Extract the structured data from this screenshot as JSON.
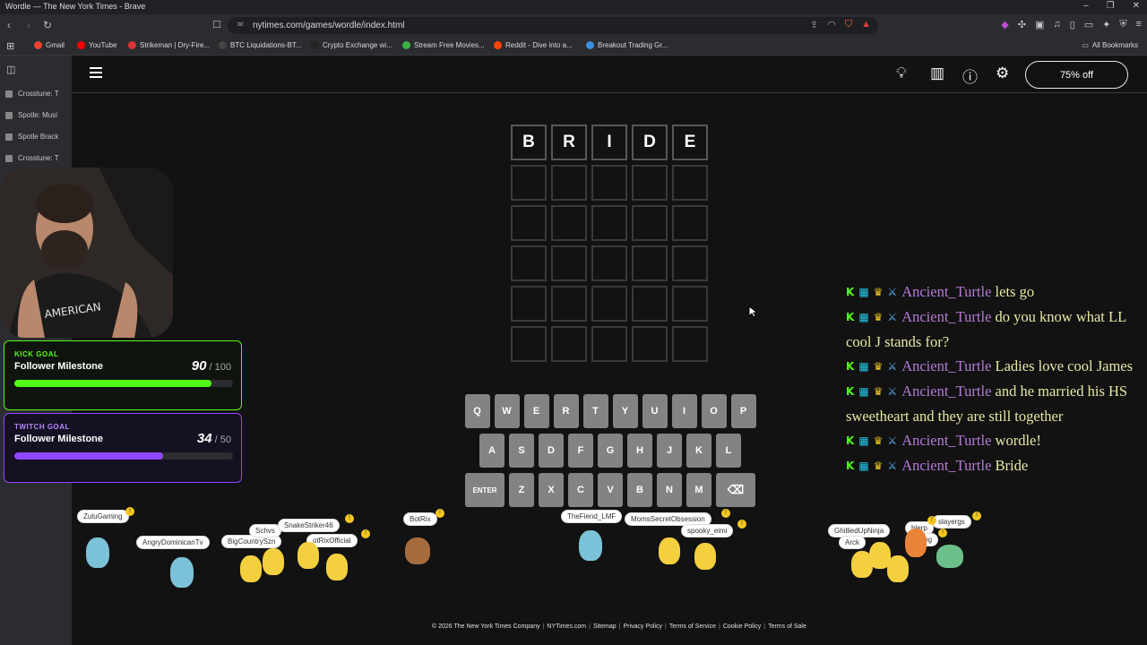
{
  "window": {
    "title": "Wordle — The New York Times - Brave",
    "controls": [
      "–",
      "❐",
      "✕"
    ]
  },
  "browser": {
    "url": "nytimes.com/games/wordle/index.html",
    "all_bookmarks": "All Bookmarks",
    "bookmarks": [
      {
        "label": "Gmail",
        "color": "#ea4335"
      },
      {
        "label": "YouTube",
        "color": "#ff0000"
      },
      {
        "label": "Strikeman | Dry-Fire...",
        "color": "#d33"
      },
      {
        "label": "BTC Liquidations-BT...",
        "color": "#444"
      },
      {
        "label": "Crypto Exchange wi...",
        "color": "#222"
      },
      {
        "label": "Stream Free Movies...",
        "color": "#3cb043"
      },
      {
        "label": "Reddit - Dive into a...",
        "color": "#ff4500"
      },
      {
        "label": "Breakout Trading Gr...",
        "color": "#3b8fe0"
      }
    ]
  },
  "sidepanel": {
    "tabs": [
      {
        "label": "Crosstune: T"
      },
      {
        "label": "Spotle: Musi"
      },
      {
        "label": "Spotle Brack"
      },
      {
        "label": "Crosstune: T"
      }
    ]
  },
  "wordle": {
    "subscribe_label": "75% off",
    "icons": [
      "lightbulb-icon",
      "stats-icon",
      "help-icon",
      "settings-icon"
    ],
    "guesses": [
      [
        "B",
        "R",
        "I",
        "D",
        "E"
      ],
      [
        "",
        "",
        "",
        "",
        ""
      ],
      [
        "",
        "",
        "",
        "",
        ""
      ],
      [
        "",
        "",
        "",
        "",
        ""
      ],
      [
        "",
        "",
        "",
        "",
        ""
      ],
      [
        "",
        "",
        "",
        "",
        ""
      ]
    ],
    "keyboard": [
      [
        "Q",
        "W",
        "E",
        "R",
        "T",
        "Y",
        "U",
        "I",
        "O",
        "P"
      ],
      [
        "A",
        "S",
        "D",
        "F",
        "G",
        "H",
        "J",
        "K",
        "L"
      ],
      [
        "ENTER",
        "Z",
        "X",
        "C",
        "V",
        "B",
        "N",
        "M",
        "⌫"
      ]
    ],
    "footer": [
      "© 2026 The New York Times Company",
      "NYTimes.com",
      "Sitemap",
      "Privacy Policy",
      "Terms of Service",
      "Cookie Policy",
      "Terms of Sale"
    ]
  },
  "goals": {
    "kick": {
      "label": "KICK GOAL",
      "name": "Follower Milestone",
      "current": "90",
      "target": "100",
      "progress": 0.9
    },
    "twitch": {
      "label": "TWITCH GOAL",
      "name": "Follower Milestone",
      "current": "34",
      "target": "50",
      "progress": 0.68
    }
  },
  "chat": {
    "messages": [
      {
        "user": "Ancient_Turtle",
        "text": "lets go"
      },
      {
        "user": "Ancient_Turtle",
        "text": "do you know what LL cool J stands for?"
      },
      {
        "user": "Ancient_Turtle",
        "text": "Ladies love cool James"
      },
      {
        "user": "Ancient_Turtle",
        "text": "and he married his HS sweetheart and they are still together"
      },
      {
        "user": "Ancient_Turtle",
        "text": "wordle!"
      },
      {
        "user": "Ancient_Turtle",
        "text": "Bride"
      }
    ]
  },
  "pokemon_viewers": {
    "names": [
      "ZuluGaming",
      "AngryDominicanTv",
      "BigCountrySzn",
      "Schvs",
      "SnakeStriker46",
      "otRixOfficial",
      "BotRix",
      "TheFiend_LMF",
      "MomsSecretObsession",
      "spooky_eimi",
      "GhilliedUpNinja",
      "slayergs",
      "blerp",
      "Arck",
      "ning"
    ]
  }
}
